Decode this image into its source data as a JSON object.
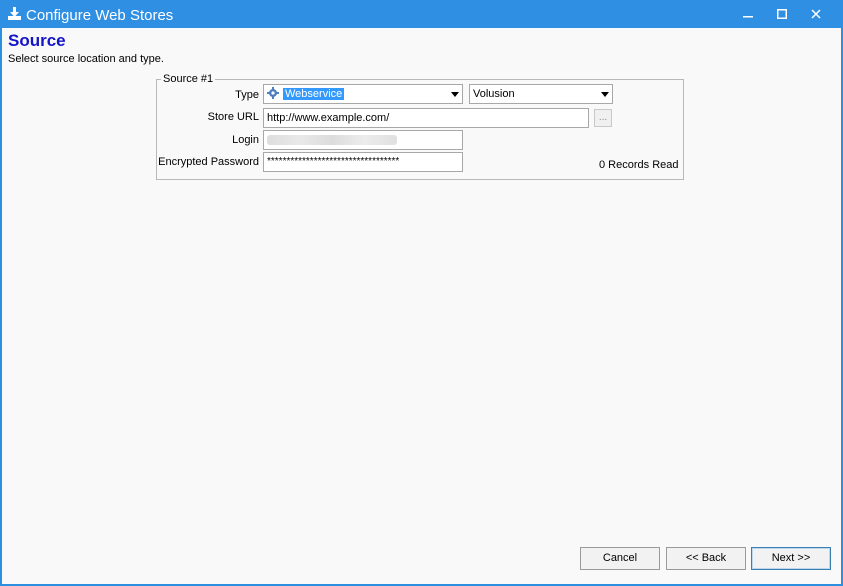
{
  "window": {
    "title": "Configure Web Stores",
    "controls": {
      "minimize": "—",
      "maximize": "☐",
      "close": "✕"
    }
  },
  "page": {
    "heading": "Source",
    "subheading": "Select source location and type."
  },
  "source_group": {
    "legend": "Source #1",
    "type_label": "Type",
    "type_value": "Webservice",
    "platform_value": "Volusion",
    "store_url_label": "Store URL",
    "store_url_value": "http://www.example.com/",
    "browse_label": "...",
    "login_label": "Login",
    "password_label": "Encrypted Password",
    "password_value": "**********************************",
    "records_status": "0 Records Read"
  },
  "buttons": {
    "cancel": "Cancel",
    "back": "<< Back",
    "next": "Next >>"
  },
  "colors": {
    "title_bar": "#2f8fe2",
    "heading": "#1515c8",
    "selection": "#3399ff"
  }
}
